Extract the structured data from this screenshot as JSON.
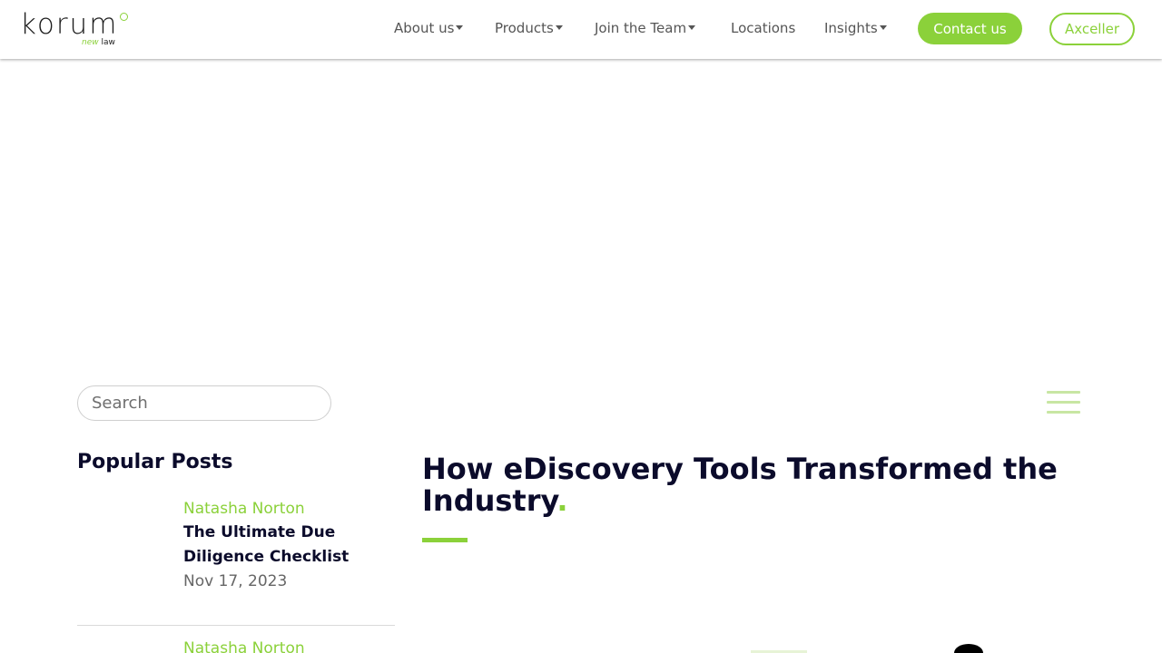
{
  "header": {
    "logo": {
      "word": "korum",
      "sub_prefix": "new",
      "sub_suffix": "law"
    },
    "nav": [
      {
        "label": "About us",
        "dropdown": true
      },
      {
        "label": "Products",
        "dropdown": true
      },
      {
        "label": "Join the Team",
        "dropdown": true
      },
      {
        "label": "Locations",
        "dropdown": false
      },
      {
        "label": "Insights",
        "dropdown": true
      }
    ],
    "contact_label": "Contact us",
    "axceller_label": "Axceller"
  },
  "search": {
    "placeholder": "Search"
  },
  "sidebar": {
    "popular_title": "Popular Posts",
    "posts": [
      {
        "author": "Natasha Norton",
        "title": "The Ultimate Due Diligence Checklist",
        "date": "Nov 17, 2023"
      },
      {
        "author": "Natasha Norton",
        "title": "",
        "date": ""
      }
    ]
  },
  "article": {
    "title": "How eDiscovery Tools Transformed the Industry",
    "title_dot": "."
  },
  "colors": {
    "accent": "#8bd13a",
    "text": "#0b0b2b",
    "nav_text": "#555555"
  },
  "icons": {
    "menu": "hamburger-icon",
    "caret": "caret-down-icon"
  }
}
